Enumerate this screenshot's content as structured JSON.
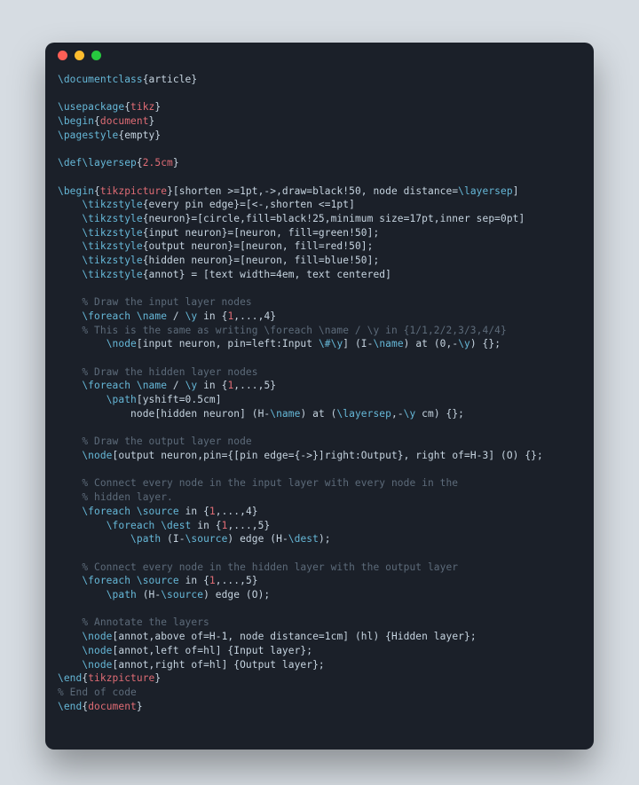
{
  "window": {
    "buttons": [
      "close",
      "minimize",
      "zoom"
    ]
  },
  "code": {
    "l01_a": "\\documentclass",
    "l01_b": "{article}",
    "l03_a": "\\usepackage",
    "l03_b": "{",
    "l03_c": "tikz",
    "l03_d": "}",
    "l04_a": "\\begin",
    "l04_b": "{",
    "l04_c": "document",
    "l04_d": "}",
    "l05_a": "\\pagestyle",
    "l05_b": "{empty}",
    "l07_a": "\\def\\layersep",
    "l07_b": "{",
    "l07_c": "2.5cm",
    "l07_d": "}",
    "l09_a": "\\begin",
    "l09_b": "{",
    "l09_c": "tikzpicture",
    "l09_d": "}[shorten >=1pt,->,draw=black!50, node distance=",
    "l09_e": "\\layersep",
    "l09_f": "]",
    "l10_a": "    ",
    "l10_b": "\\tikzstyle",
    "l10_c": "{every pin edge}=[<-,shorten <=1pt]",
    "l11_a": "    ",
    "l11_b": "\\tikzstyle",
    "l11_c": "{neuron}=[circle,fill=black!25,minimum size=17pt,inner sep=0pt]",
    "l12_a": "    ",
    "l12_b": "\\tikzstyle",
    "l12_c": "{input neuron}=[neuron, fill=green!50];",
    "l13_a": "    ",
    "l13_b": "\\tikzstyle",
    "l13_c": "{output neuron}=[neuron, fill=red!50];",
    "l14_a": "    ",
    "l14_b": "\\tikzstyle",
    "l14_c": "{hidden neuron}=[neuron, fill=blue!50];",
    "l15_a": "    ",
    "l15_b": "\\tikzstyle",
    "l15_c": "{annot} = [text width=4em, text centered]",
    "l17": "    % Draw the input layer nodes",
    "l18_a": "    ",
    "l18_b": "\\foreach",
    "l18_c": " ",
    "l18_d": "\\name",
    "l18_e": " / ",
    "l18_f": "\\y",
    "l18_g": " in {",
    "l18_h": "1",
    "l18_i": ",...,4}",
    "l19": "    % This is the same as writing \\foreach \\name / \\y in {1/1,2/2,3/3,4/4}",
    "l20_a": "        ",
    "l20_b": "\\node",
    "l20_c": "[input neuron, pin=left:Input ",
    "l20_d": "\\#\\y",
    "l20_e": "] (I-",
    "l20_f": "\\name",
    "l20_g": ") at (0,-",
    "l20_h": "\\y",
    "l20_i": ") {};",
    "l22": "    % Draw the hidden layer nodes",
    "l23_a": "    ",
    "l23_b": "\\foreach",
    "l23_c": " ",
    "l23_d": "\\name",
    "l23_e": " / ",
    "l23_f": "\\y",
    "l23_g": " in {",
    "l23_h": "1",
    "l23_i": ",...,5}",
    "l24_a": "        ",
    "l24_b": "\\path",
    "l24_c": "[yshift=0.5cm]",
    "l25_a": "            node[hidden neuron] (H-",
    "l25_b": "\\name",
    "l25_c": ") at (",
    "l25_d": "\\layersep",
    "l25_e": ",-",
    "l25_f": "\\y",
    "l25_g": " cm) {};",
    "l27": "    % Draw the output layer node",
    "l28_a": "    ",
    "l28_b": "\\node",
    "l28_c": "[output neuron,pin={[pin edge={->}]right:Output}, right of=H-3] (O) {};",
    "l30": "    % Connect every node in the input layer with every node in the",
    "l31": "    % hidden layer.",
    "l32_a": "    ",
    "l32_b": "\\foreach",
    "l32_c": " ",
    "l32_d": "\\source",
    "l32_e": " in {",
    "l32_f": "1",
    "l32_g": ",...,4}",
    "l33_a": "        ",
    "l33_b": "\\foreach",
    "l33_c": " ",
    "l33_d": "\\dest",
    "l33_e": " in {",
    "l33_f": "1",
    "l33_g": ",...,5}",
    "l34_a": "            ",
    "l34_b": "\\path",
    "l34_c": " (I-",
    "l34_d": "\\source",
    "l34_e": ") edge (H-",
    "l34_f": "\\dest",
    "l34_g": ");",
    "l36": "    % Connect every node in the hidden layer with the output layer",
    "l37_a": "    ",
    "l37_b": "\\foreach",
    "l37_c": " ",
    "l37_d": "\\source",
    "l37_e": " in {",
    "l37_f": "1",
    "l37_g": ",...,5}",
    "l38_a": "        ",
    "l38_b": "\\path",
    "l38_c": " (H-",
    "l38_d": "\\source",
    "l38_e": ") edge (O);",
    "l40": "    % Annotate the layers",
    "l41_a": "    ",
    "l41_b": "\\node",
    "l41_c": "[annot,above of=H-1, node distance=1cm] (hl) {Hidden layer};",
    "l42_a": "    ",
    "l42_b": "\\node",
    "l42_c": "[annot,left of=hl] {Input layer};",
    "l43_a": "    ",
    "l43_b": "\\node",
    "l43_c": "[annot,right of=hl] {Output layer};",
    "l44_a": "\\end",
    "l44_b": "{",
    "l44_c": "tikzpicture",
    "l44_d": "}",
    "l45": "% End of code",
    "l46_a": "\\end",
    "l46_b": "{",
    "l46_c": "document",
    "l46_d": "}"
  }
}
